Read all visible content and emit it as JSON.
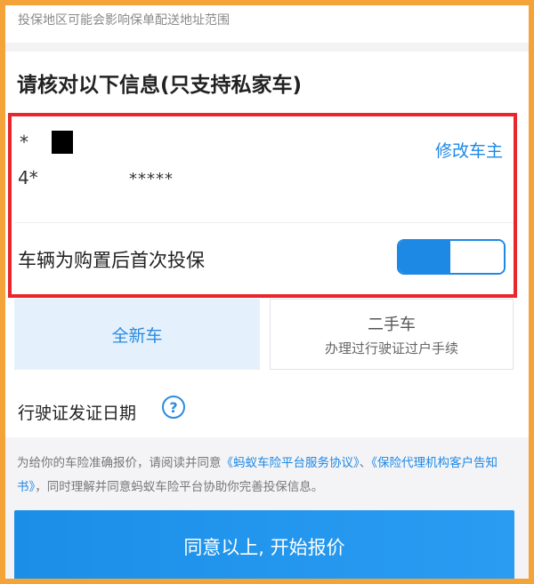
{
  "header": {
    "hint": "投保地区可能会影响保单配送地址范围"
  },
  "section": {
    "title": "请核对以下信息(只支持私家车)"
  },
  "vehicle_info": {
    "line1_prefix": "*",
    "line2_prefix": "4*",
    "line2_masked": "*****",
    "edit_owner_label": "修改车主"
  },
  "first_purchase": {
    "label": "车辆为购置后首次投保",
    "enabled": true
  },
  "car_type_tabs": [
    {
      "label": "全新车",
      "selected": true
    },
    {
      "label": "二手车",
      "subtitle": "办理过行驶证过户手续",
      "selected": false
    }
  ],
  "license_date": {
    "label": "行驶证发证日期",
    "help_glyph": "?"
  },
  "agreement": {
    "text_before": "为给你的车险准确报价，请阅读并同意",
    "link1": "《蚂蚁车险平台服务协议》",
    "separator": "、",
    "link2": "《保险代理机构客户告知书》",
    "text_after": "，同时理解并同意蚂蚁车险平台协助你完善投保信息。"
  },
  "cta": {
    "label": "同意以上, 开始报价"
  },
  "colors": {
    "accent": "#1e88e5",
    "highlight_border": "#e8262c",
    "frame_border": "#f3a338"
  }
}
